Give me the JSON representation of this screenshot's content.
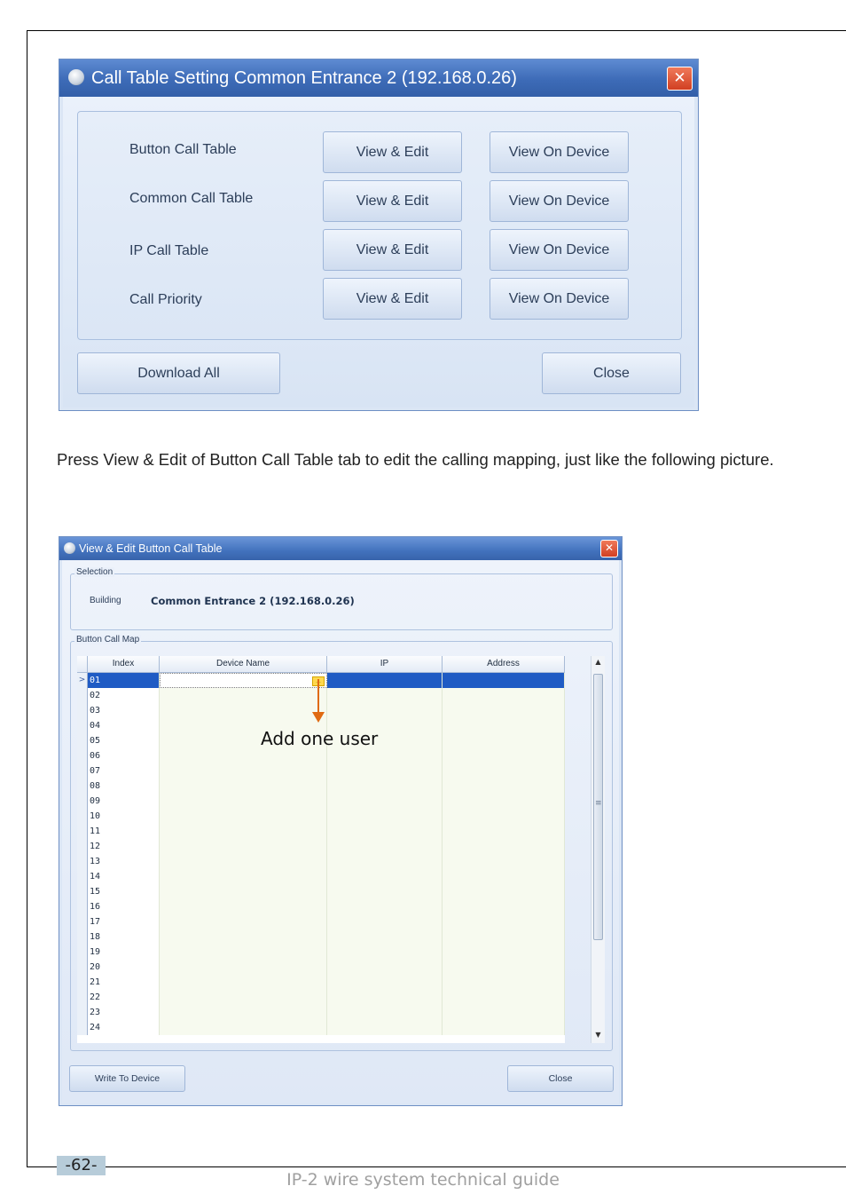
{
  "dialog1": {
    "title": "Call Table Setting Common Entrance 2 (192.168.0.26)",
    "close_glyph": "✕",
    "rows": [
      {
        "label": "Button Call Table",
        "edit_label": "View & Edit",
        "device_label": "View On Device"
      },
      {
        "label": "Common Call Table",
        "edit_label": "View & Edit",
        "device_label": "View On Device"
      },
      {
        "label": "IP Call Table",
        "edit_label": "View & Edit",
        "device_label": "View On Device"
      },
      {
        "label": "Call Priority",
        "edit_label": "View & Edit",
        "device_label": "View On Device"
      }
    ],
    "download_all_label": "Download All",
    "close_label": "Close"
  },
  "paragraph": "Press View & Edit of Button Call Table tab to edit the calling mapping, just like the following picture.",
  "dialog2": {
    "title": "View & Edit Button Call Table",
    "close_glyph": "✕",
    "selection_legend": "Selection",
    "building_label": "Building",
    "building_value": "Common Entrance 2 (192.168.0.26)",
    "map_legend": "Button Call Map",
    "columns": [
      "Index",
      "Device Name",
      "IP",
      "Address"
    ],
    "rows": [
      "01",
      "02",
      "03",
      "04",
      "05",
      "06",
      "07",
      "08",
      "09",
      "10",
      "11",
      "12",
      "13",
      "14",
      "15",
      "16",
      "17",
      "18",
      "19",
      "20",
      "21",
      "22",
      "23",
      "24"
    ],
    "selected_row_marker": ">",
    "edit_button_glyph": "...",
    "scroll_up": "▲",
    "scroll_down": "▼",
    "scroll_grip": "≡",
    "write_label": "Write To Device",
    "close_label": "Close"
  },
  "annotation": "Add one user",
  "page_number": "-62-",
  "footer": "IP-2 wire system technical guide",
  "colors": {
    "title_bar": "#3d6bb7",
    "selected_row": "#1f5bc4",
    "annotation_arrow": "#e06a12",
    "close_button": "#d13f22"
  }
}
